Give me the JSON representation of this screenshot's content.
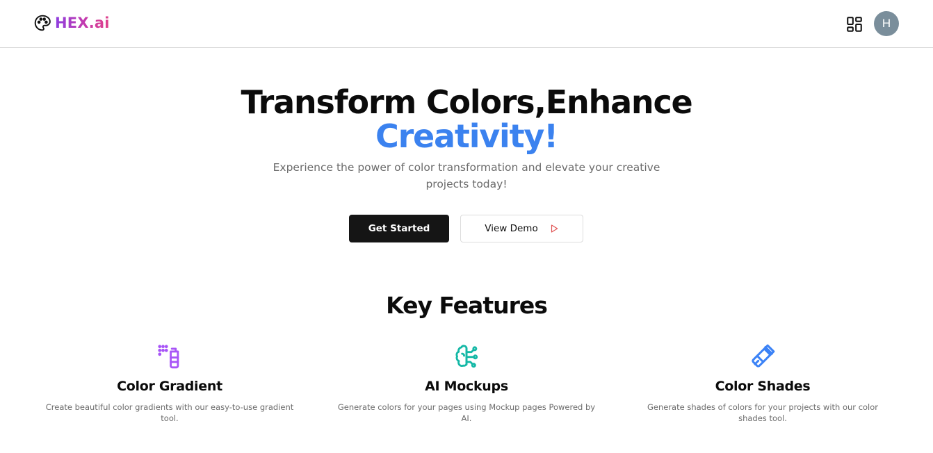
{
  "navbar": {
    "brand_name": "HEX.ai",
    "brand_icon": "palette-icon",
    "apps_icon": "apps-grid-icon",
    "avatar_initial": "H"
  },
  "hero": {
    "title_line1": "Transform Colors,Enhance",
    "title_line2": "Creativity!",
    "subtitle": "Experience the power of color transformation and elevate your creative projects today!",
    "primary_button": "Get Started",
    "secondary_button": "View Demo",
    "secondary_button_icon": "play-icon"
  },
  "features": {
    "title": "Key Features",
    "items": [
      {
        "icon": "spray-bottle-icon",
        "title": "Color Gradient",
        "description": "Create beautiful color gradients with our easy-to-use gradient tool."
      },
      {
        "icon": "brain-circuit-icon",
        "title": "AI Mockups",
        "description": "Generate colors for your pages using Mockup pages Powered by AI."
      },
      {
        "icon": "paintbrush-icon",
        "title": "Color Shades",
        "description": "Generate shades of colors for your projects with our color shades tool."
      }
    ]
  },
  "colors": {
    "accent_blue": "#3b82ef",
    "brand_gradient_start": "#8e3fe0",
    "brand_gradient_end": "#e0428a",
    "primary_button_bg": "#151515",
    "gradient_icon": "#a855f7",
    "ai_icon": "#14b8a6",
    "shades_icon": "#3b82f6",
    "play_icon": "#e05252",
    "avatar_bg": "#7a8e9b"
  }
}
